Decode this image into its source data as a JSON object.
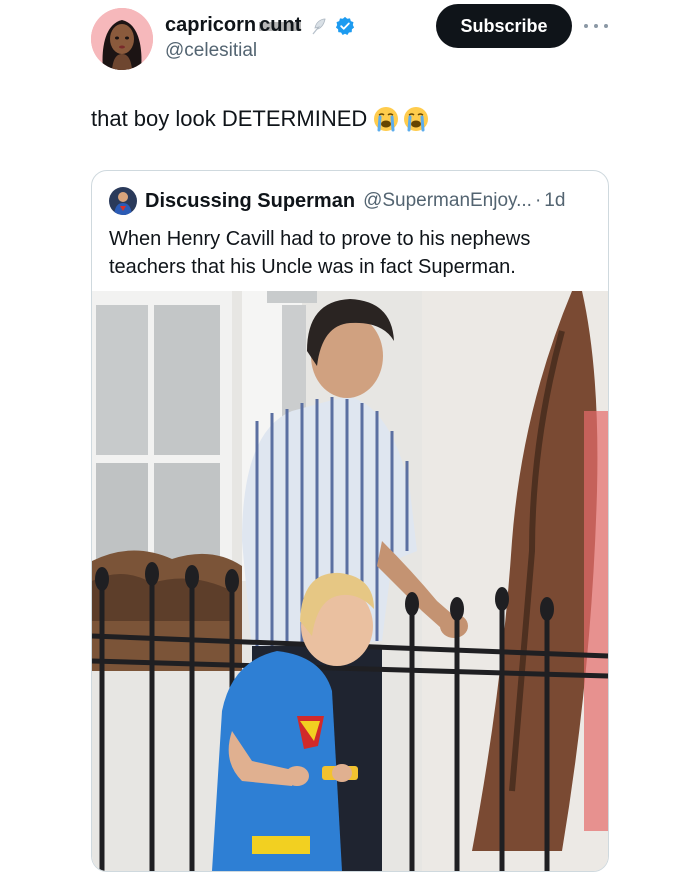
{
  "author": {
    "display_name": "capricorn",
    "display_name_redacted": "cunt",
    "handle": "@celesitial",
    "avatar_icon": "profile-avatar",
    "feather_icon": "feather-icon",
    "verified_icon": "verified-badge-icon",
    "verified_color": "#1d9bf0"
  },
  "actions": {
    "subscribe_label": "Subscribe",
    "more_icon": "more-icon"
  },
  "tweet": {
    "text": "that boy look DETERMINED",
    "emojis": [
      "loudly-crying-face",
      "loudly-crying-face"
    ]
  },
  "quote": {
    "name": "Discussing Superman",
    "handle": "@SupermanEnjoy...",
    "separator": "·",
    "time": "1d",
    "text": "When Henry Cavill had to prove to his nephews teachers that his Uncle was in fact Superman.",
    "photo_icon": "photo"
  }
}
